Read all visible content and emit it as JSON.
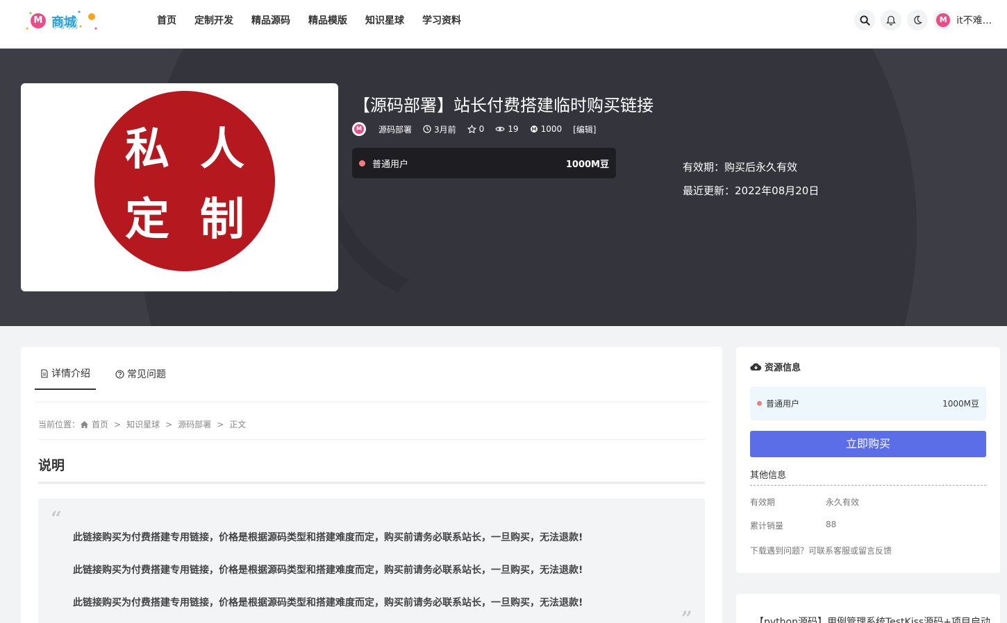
{
  "header": {
    "logo_text": "商城",
    "nav": [
      "首页",
      "定制开发",
      "精品源码",
      "精品模版",
      "知识星球",
      "学习资料"
    ],
    "user_name": "it不难..."
  },
  "hero": {
    "cover_text": [
      "私",
      "人",
      "定",
      "制"
    ],
    "title": "【源码部署】站长付费搭建临时购买链接",
    "author": "源码部署",
    "time": "3月前",
    "favorites": "0",
    "views": "19",
    "price_meta": "1000",
    "edit": "[编辑]",
    "price_box": {
      "label": "普通用户",
      "amount": "1000M豆"
    },
    "validity": "有效期：购买后永久有效",
    "updated": "最近更新：2022年08月20日"
  },
  "main": {
    "tabs": [
      "详情介绍",
      "常见问题"
    ],
    "breadcrumb": {
      "prefix": "当前位置：",
      "items": [
        "首页",
        "知识星球",
        "源码部署",
        "正文"
      ]
    },
    "section_title": "说明",
    "quote_lines": [
      "此链接购买为付费搭建专用链接，价格是根据源码类型和搭建难度而定，购买前请务必联系站长，一旦购买，无法退款!",
      "此链接购买为付费搭建专用链接，价格是根据源码类型和搭建难度而定，购买前请务必联系站长，一旦购买，无法退款!",
      "此链接购买为付费搭建专用链接，价格是根据源码类型和搭建难度而定，购买前请务必联系站长，一旦购买，无法退款!"
    ]
  },
  "sidebar": {
    "title": "资源信息",
    "price_label": "普通用户",
    "price_amount": "1000M豆",
    "buy_label": "立即购买",
    "other_title": "其他信息",
    "rows": [
      {
        "k": "有效期",
        "v": "永久有效"
      },
      {
        "k": "累计销量",
        "v": "88"
      }
    ],
    "help": "下载遇到问题？可联系客服或留言反馈",
    "next_card_title": "【python源码】用例管理系统TestKiss源码+项目启动"
  },
  "colors": {
    "accent": "#5b6ee8",
    "brand_pink": "#ea4c89",
    "hero_bg": "#3d3d46",
    "seal_red": "#b5191f"
  }
}
